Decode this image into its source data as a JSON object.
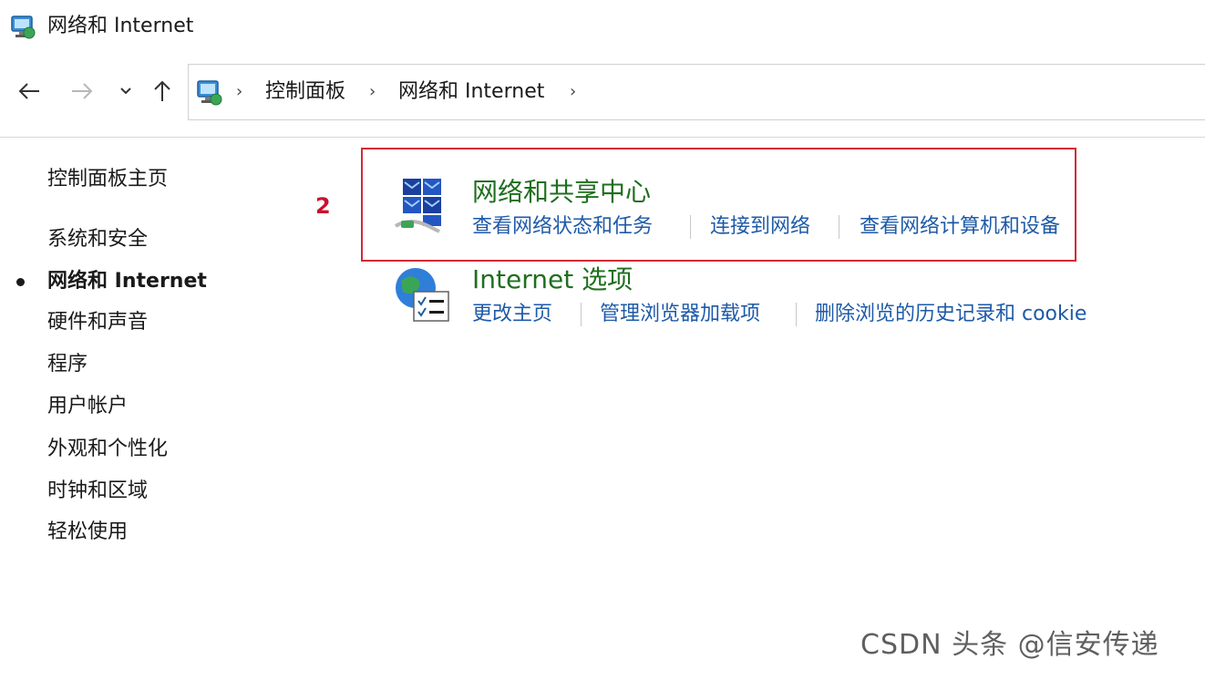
{
  "window": {
    "title": "网络和 Internet",
    "title_icon": "network-internet-icon"
  },
  "nav": {
    "back_icon": "arrow-left-icon",
    "forward_icon": "arrow-right-icon",
    "recent_icon": "chevron-down-icon",
    "up_icon": "arrow-up-icon"
  },
  "address": {
    "icon": "control-panel-icon",
    "separator": "›",
    "crumbs": [
      "控制面板",
      "网络和 Internet"
    ]
  },
  "sidebar": {
    "home": "控制面板主页",
    "items": [
      {
        "label": "系统和安全",
        "active": false
      },
      {
        "label": "网络和 Internet",
        "active": true
      },
      {
        "label": "硬件和声音",
        "active": false
      },
      {
        "label": "程序",
        "active": false
      },
      {
        "label": "用户帐户",
        "active": false
      },
      {
        "label": "外观和个性化",
        "active": false
      },
      {
        "label": "时钟和区域",
        "active": false
      },
      {
        "label": "轻松使用",
        "active": false
      }
    ]
  },
  "annotation": {
    "step": "2",
    "box_color": "#d12b36"
  },
  "categories": [
    {
      "title": "网络和共享中心",
      "icon": "network-sharing-center-icon",
      "links": [
        "查看网络状态和任务",
        "连接到网络",
        "查看网络计算机和设备"
      ]
    },
    {
      "title": "Internet 选项",
      "icon": "internet-options-icon",
      "links": [
        "更改主页",
        "管理浏览器加载项",
        "删除浏览的历史记录和 cookie"
      ]
    }
  ],
  "colors": {
    "category_title": "#1f6f1f",
    "link": "#1e5aa8",
    "highlight": "#d12b36"
  },
  "watermark": "CSDN 头条 @信安传递"
}
